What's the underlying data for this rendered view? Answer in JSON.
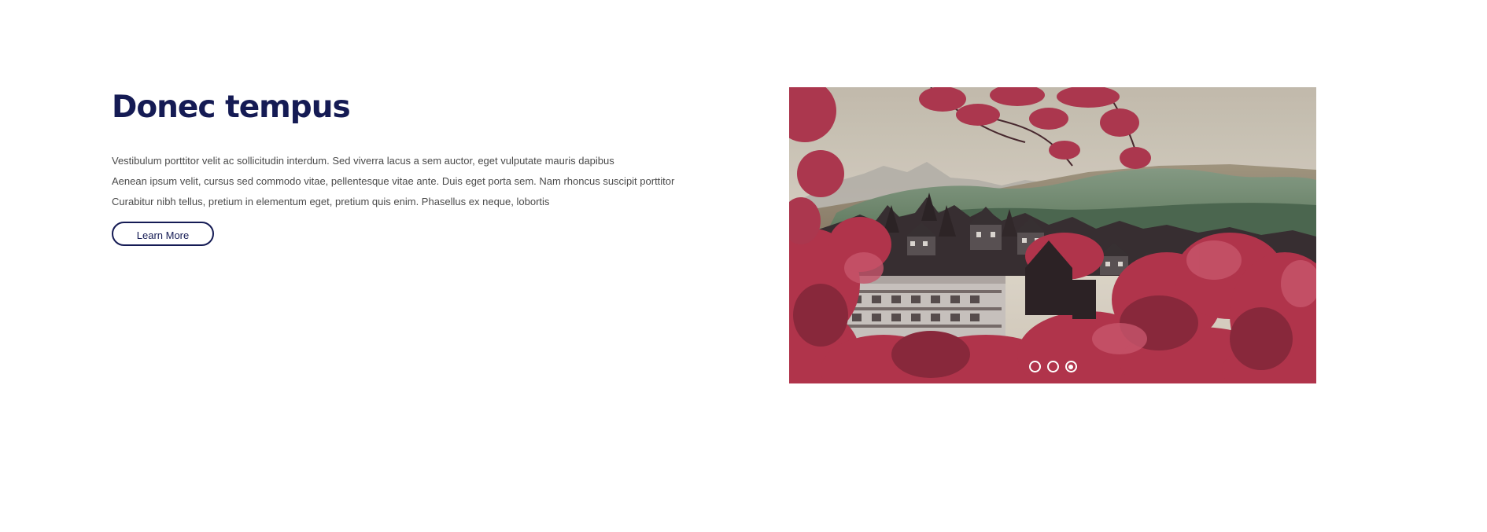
{
  "hero": {
    "title": "Donec tempus",
    "paragraph_lines": [
      "Vestibulum porttitor velit ac sollicitudin interdum. Sed viverra lacus a sem auctor, eget vulputate mauris dapibus",
      "Aenean ipsum velit, cursus sed commodo vitae, pellentesque vitae ante. Duis eget porta sem. Nam rhoncus suscipit porttitor",
      "Curabitur nibh tellus, pretium in elementum eget, pretium quis enim. Phasellus ex neque, lobortis"
    ],
    "button_label": "Learn More"
  },
  "slider": {
    "image_subject": "autumn-village-landscape",
    "slide_count": 3,
    "active_index": 2,
    "colors": {
      "title": "#151b54",
      "body_text": "#4a4a4a",
      "foliage": "#b8374f",
      "sky": "#d8d0c2",
      "hills": "#6f8a6c"
    }
  }
}
